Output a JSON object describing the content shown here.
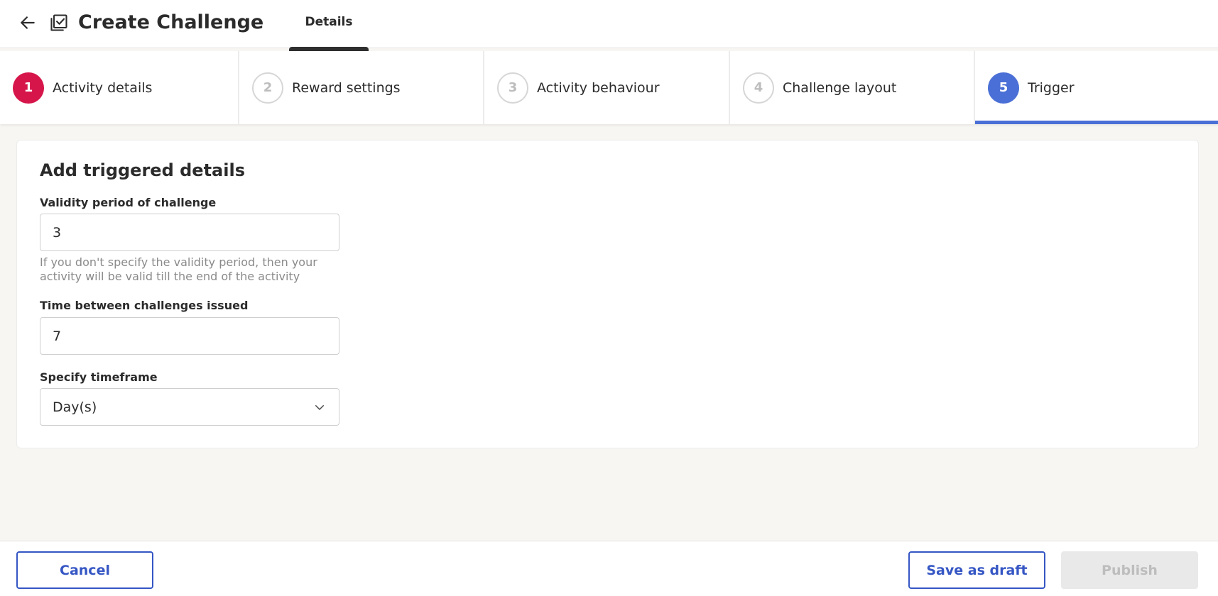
{
  "header": {
    "title": "Create Challenge",
    "tab_label": "Details"
  },
  "stepper": {
    "steps": [
      {
        "number": "1",
        "label": "Activity details"
      },
      {
        "number": "2",
        "label": "Reward settings"
      },
      {
        "number": "3",
        "label": "Activity behaviour"
      },
      {
        "number": "4",
        "label": "Challenge layout"
      },
      {
        "number": "5",
        "label": "Trigger"
      }
    ],
    "active_step": "5"
  },
  "form": {
    "title": "Add triggered details",
    "validity": {
      "label": "Validity period of challenge",
      "value": "3",
      "helper": "If you don't specify the validity period, then your activity will be valid till the end of the activity"
    },
    "time_between": {
      "label": "Time between challenges issued",
      "value": "7"
    },
    "timeframe": {
      "label": "Specify timeframe",
      "value": "Day(s)"
    }
  },
  "footer": {
    "cancel_label": "Cancel",
    "draft_label": "Save as draft",
    "publish_label": "Publish"
  },
  "colors": {
    "accent_blue": "#4a6fd6",
    "step1_red": "#d6164a",
    "button_blue": "#3556c4"
  },
  "icons": {
    "back": "arrow-left-icon",
    "title": "checklist-icon",
    "select": "chevron-down-icon"
  }
}
